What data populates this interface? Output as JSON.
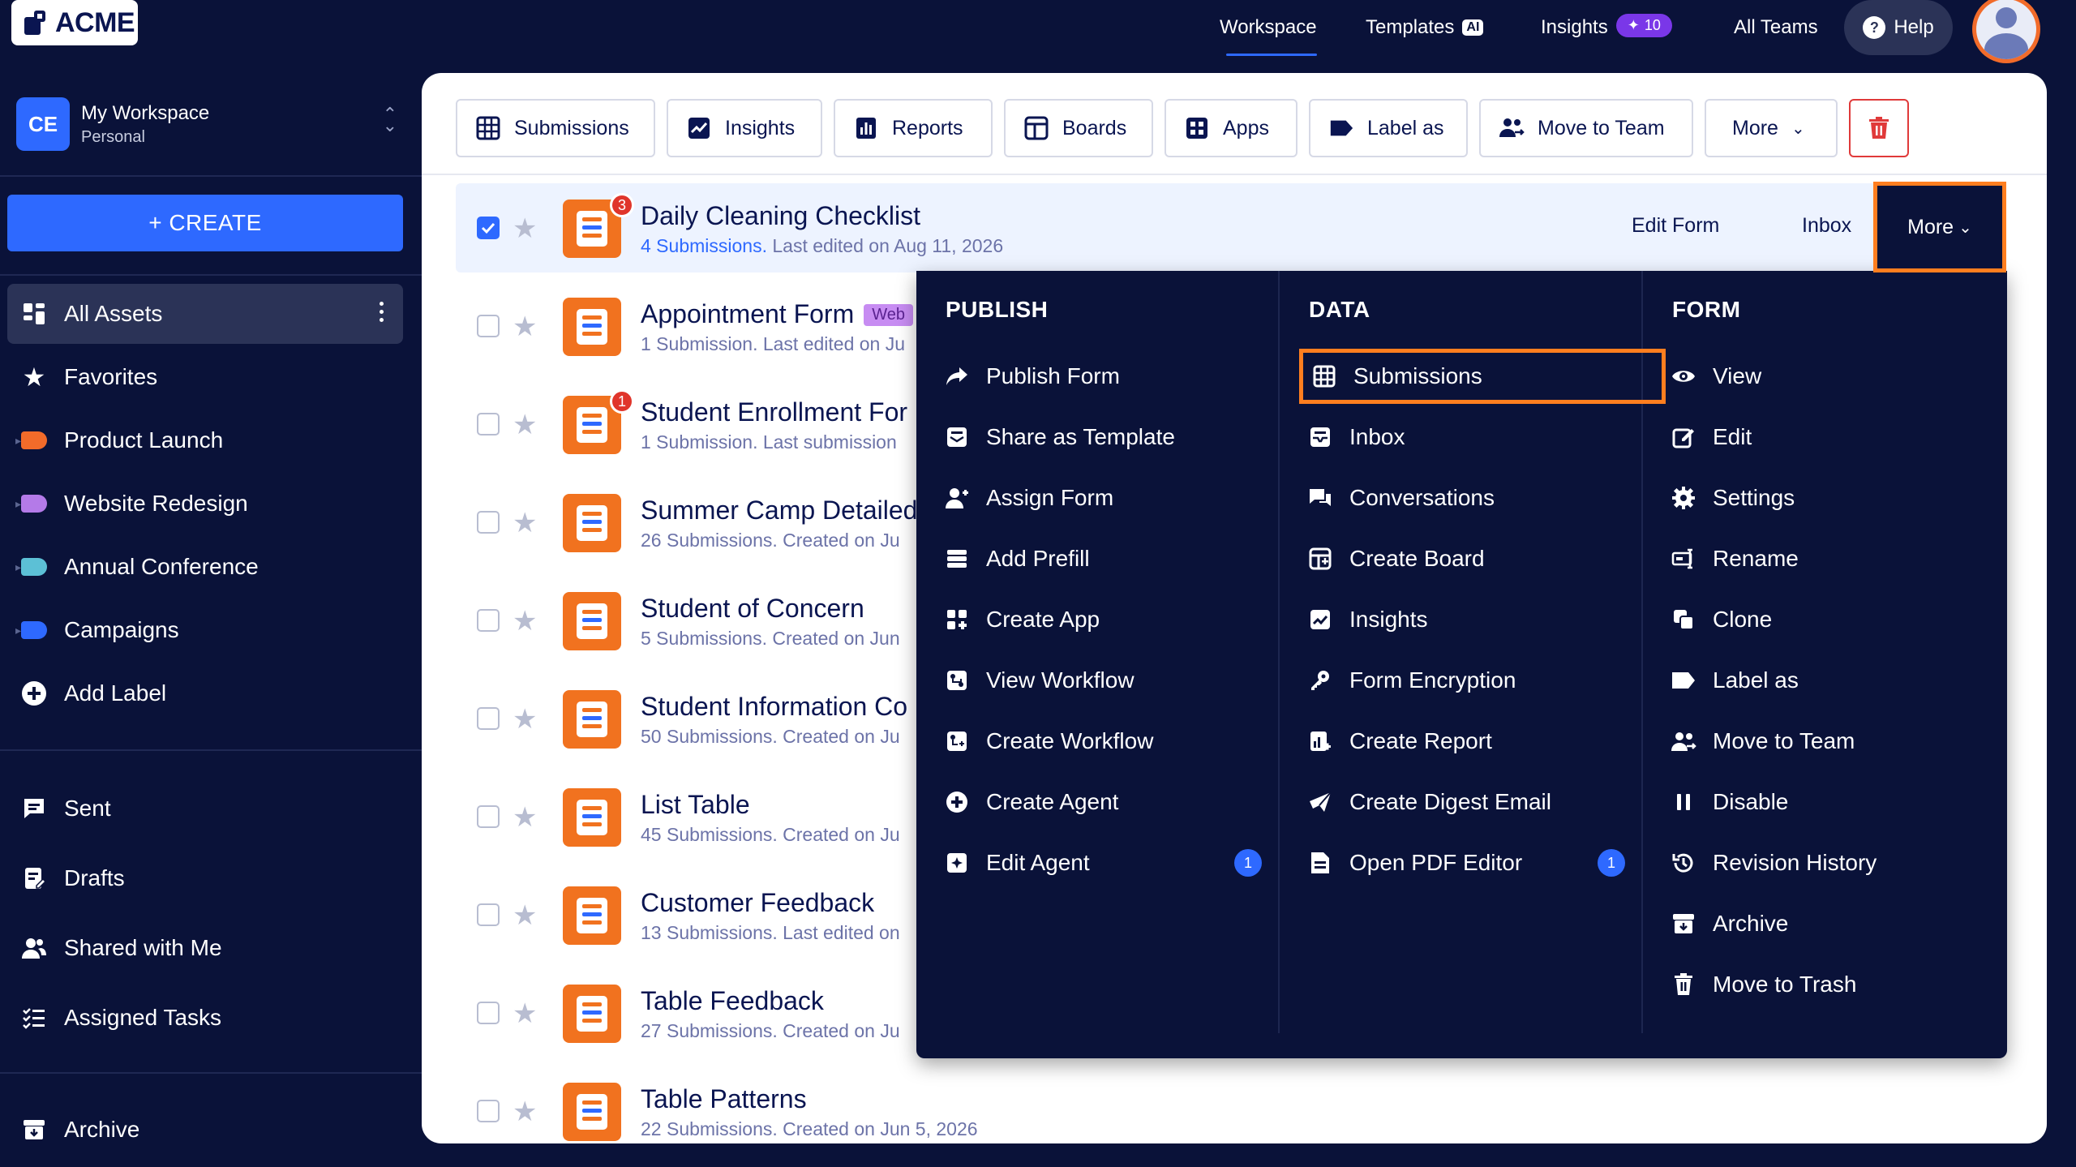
{
  "brand": {
    "logo_text": "ACME"
  },
  "nav": {
    "workspace": "Workspace",
    "templates": "Templates",
    "templates_badge": "AI",
    "insights": "Insights",
    "insights_badge": "10",
    "all_teams": "All Teams",
    "help": "Help"
  },
  "sidebar": {
    "workspace_initials": "CE",
    "workspace_name": "My Workspace",
    "workspace_type": "Personal",
    "create_label": "+ CREATE",
    "items": [
      {
        "label": "All Assets"
      },
      {
        "label": "Favorites"
      },
      {
        "label": "Product Launch",
        "color": "#f26b2a"
      },
      {
        "label": "Website Redesign",
        "color": "#b47ae8"
      },
      {
        "label": "Annual Conference",
        "color": "#5cc0d6"
      },
      {
        "label": "Campaigns",
        "color": "#2e69ff"
      },
      {
        "label": "Add Label"
      }
    ],
    "bottom": [
      {
        "label": "Sent"
      },
      {
        "label": "Drafts"
      },
      {
        "label": "Shared with Me"
      },
      {
        "label": "Assigned Tasks"
      },
      {
        "label": "Archive"
      }
    ]
  },
  "toolbar": {
    "submissions": "Submissions",
    "insights": "Insights",
    "reports": "Reports",
    "boards": "Boards",
    "apps": "Apps",
    "label_as": "Label as",
    "move_to_team": "Move to Team",
    "more": "More"
  },
  "forms": [
    {
      "title": "Daily Cleaning Checklist",
      "count": "4 Submissions.",
      "meta": " Last edited on Aug 11, 2026",
      "badge": "3"
    },
    {
      "title": "Appointment Form",
      "count": "",
      "meta": "1 Submission. Last edited on Ju",
      "tag": "Web"
    },
    {
      "title": "Student Enrollment For",
      "count": "",
      "meta": "1 Submission. Last submission",
      "badge": "1"
    },
    {
      "title": "Summer Camp Detailed",
      "count": "",
      "meta": "26 Submissions. Created on Ju"
    },
    {
      "title": "Student of Concern",
      "count": "",
      "meta": "5 Submissions. Created on Jun"
    },
    {
      "title": "Student Information Co",
      "count": "",
      "meta": "50 Submissions. Created on Ju"
    },
    {
      "title": "List Table",
      "count": "",
      "meta": "45 Submissions. Created on Ju"
    },
    {
      "title": "Customer Feedback",
      "count": "",
      "meta": "13 Submissions. Last edited on"
    },
    {
      "title": "Table Feedback",
      "count": "",
      "meta": "27 Submissions. Created on Ju"
    },
    {
      "title": "Table Patterns",
      "count": "",
      "meta": "22 Submissions. Created on Jun 5, 2026"
    }
  ],
  "row_actions": {
    "edit_form": "Edit Form",
    "inbox": "Inbox",
    "more": "More"
  },
  "dropdown": {
    "publish": {
      "heading": "PUBLISH",
      "items": [
        "Publish Form",
        "Share as Template",
        "Assign Form",
        "Add Prefill",
        "Create App",
        "View Workflow",
        "Create Workflow",
        "Create Agent",
        "Edit Agent"
      ],
      "edit_agent_count": "1"
    },
    "data": {
      "heading": "DATA",
      "items": [
        "Submissions",
        "Inbox",
        "Conversations",
        "Create Board",
        "Insights",
        "Form Encryption",
        "Create Report",
        "Create Digest Email",
        "Open PDF Editor"
      ],
      "pdf_count": "1"
    },
    "form": {
      "heading": "FORM",
      "items": [
        "View",
        "Edit",
        "Settings",
        "Rename",
        "Clone",
        "Label as",
        "Move to Team",
        "Disable",
        "Revision History",
        "Archive",
        "Move to Trash"
      ]
    }
  },
  "colors": {
    "accent": "#2e69ff",
    "highlight": "#ff7e1f",
    "navy": "#0a1239",
    "form_icon": "#f1721f"
  }
}
